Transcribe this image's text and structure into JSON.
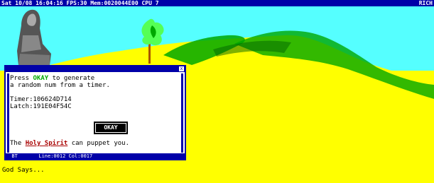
{
  "topbar": {
    "status": "Sat 10/08 16:04:16 FPS:30 Mem:0020044E00 CPU 7",
    "right_label": "RICH"
  },
  "dialog": {
    "title": "",
    "close_label": "x",
    "text_line1_pre": "Press ",
    "text_line1_highlight": "OKAY",
    "text_line1_post": " to generate",
    "text_line2": "a random num from a timer.",
    "timer_line": "Timer:106624D714",
    "latch_line": "Latch:191E04F54C",
    "ok_button_label": "OKAY",
    "bottom_pre": "The ",
    "bottom_highlight": "Holy Spirit",
    "bottom_post": " can puppet you.",
    "status_line": "  BT       Line:0012 Col:0017"
  },
  "footer": {
    "god_says": "God Says..."
  },
  "colors": {
    "sky": "#55ffff",
    "ground": "#ffff00",
    "hill": "#00a800",
    "window_blue": "#0000a8",
    "highlight_green": "#00a800",
    "highlight_red": "#a80000"
  }
}
